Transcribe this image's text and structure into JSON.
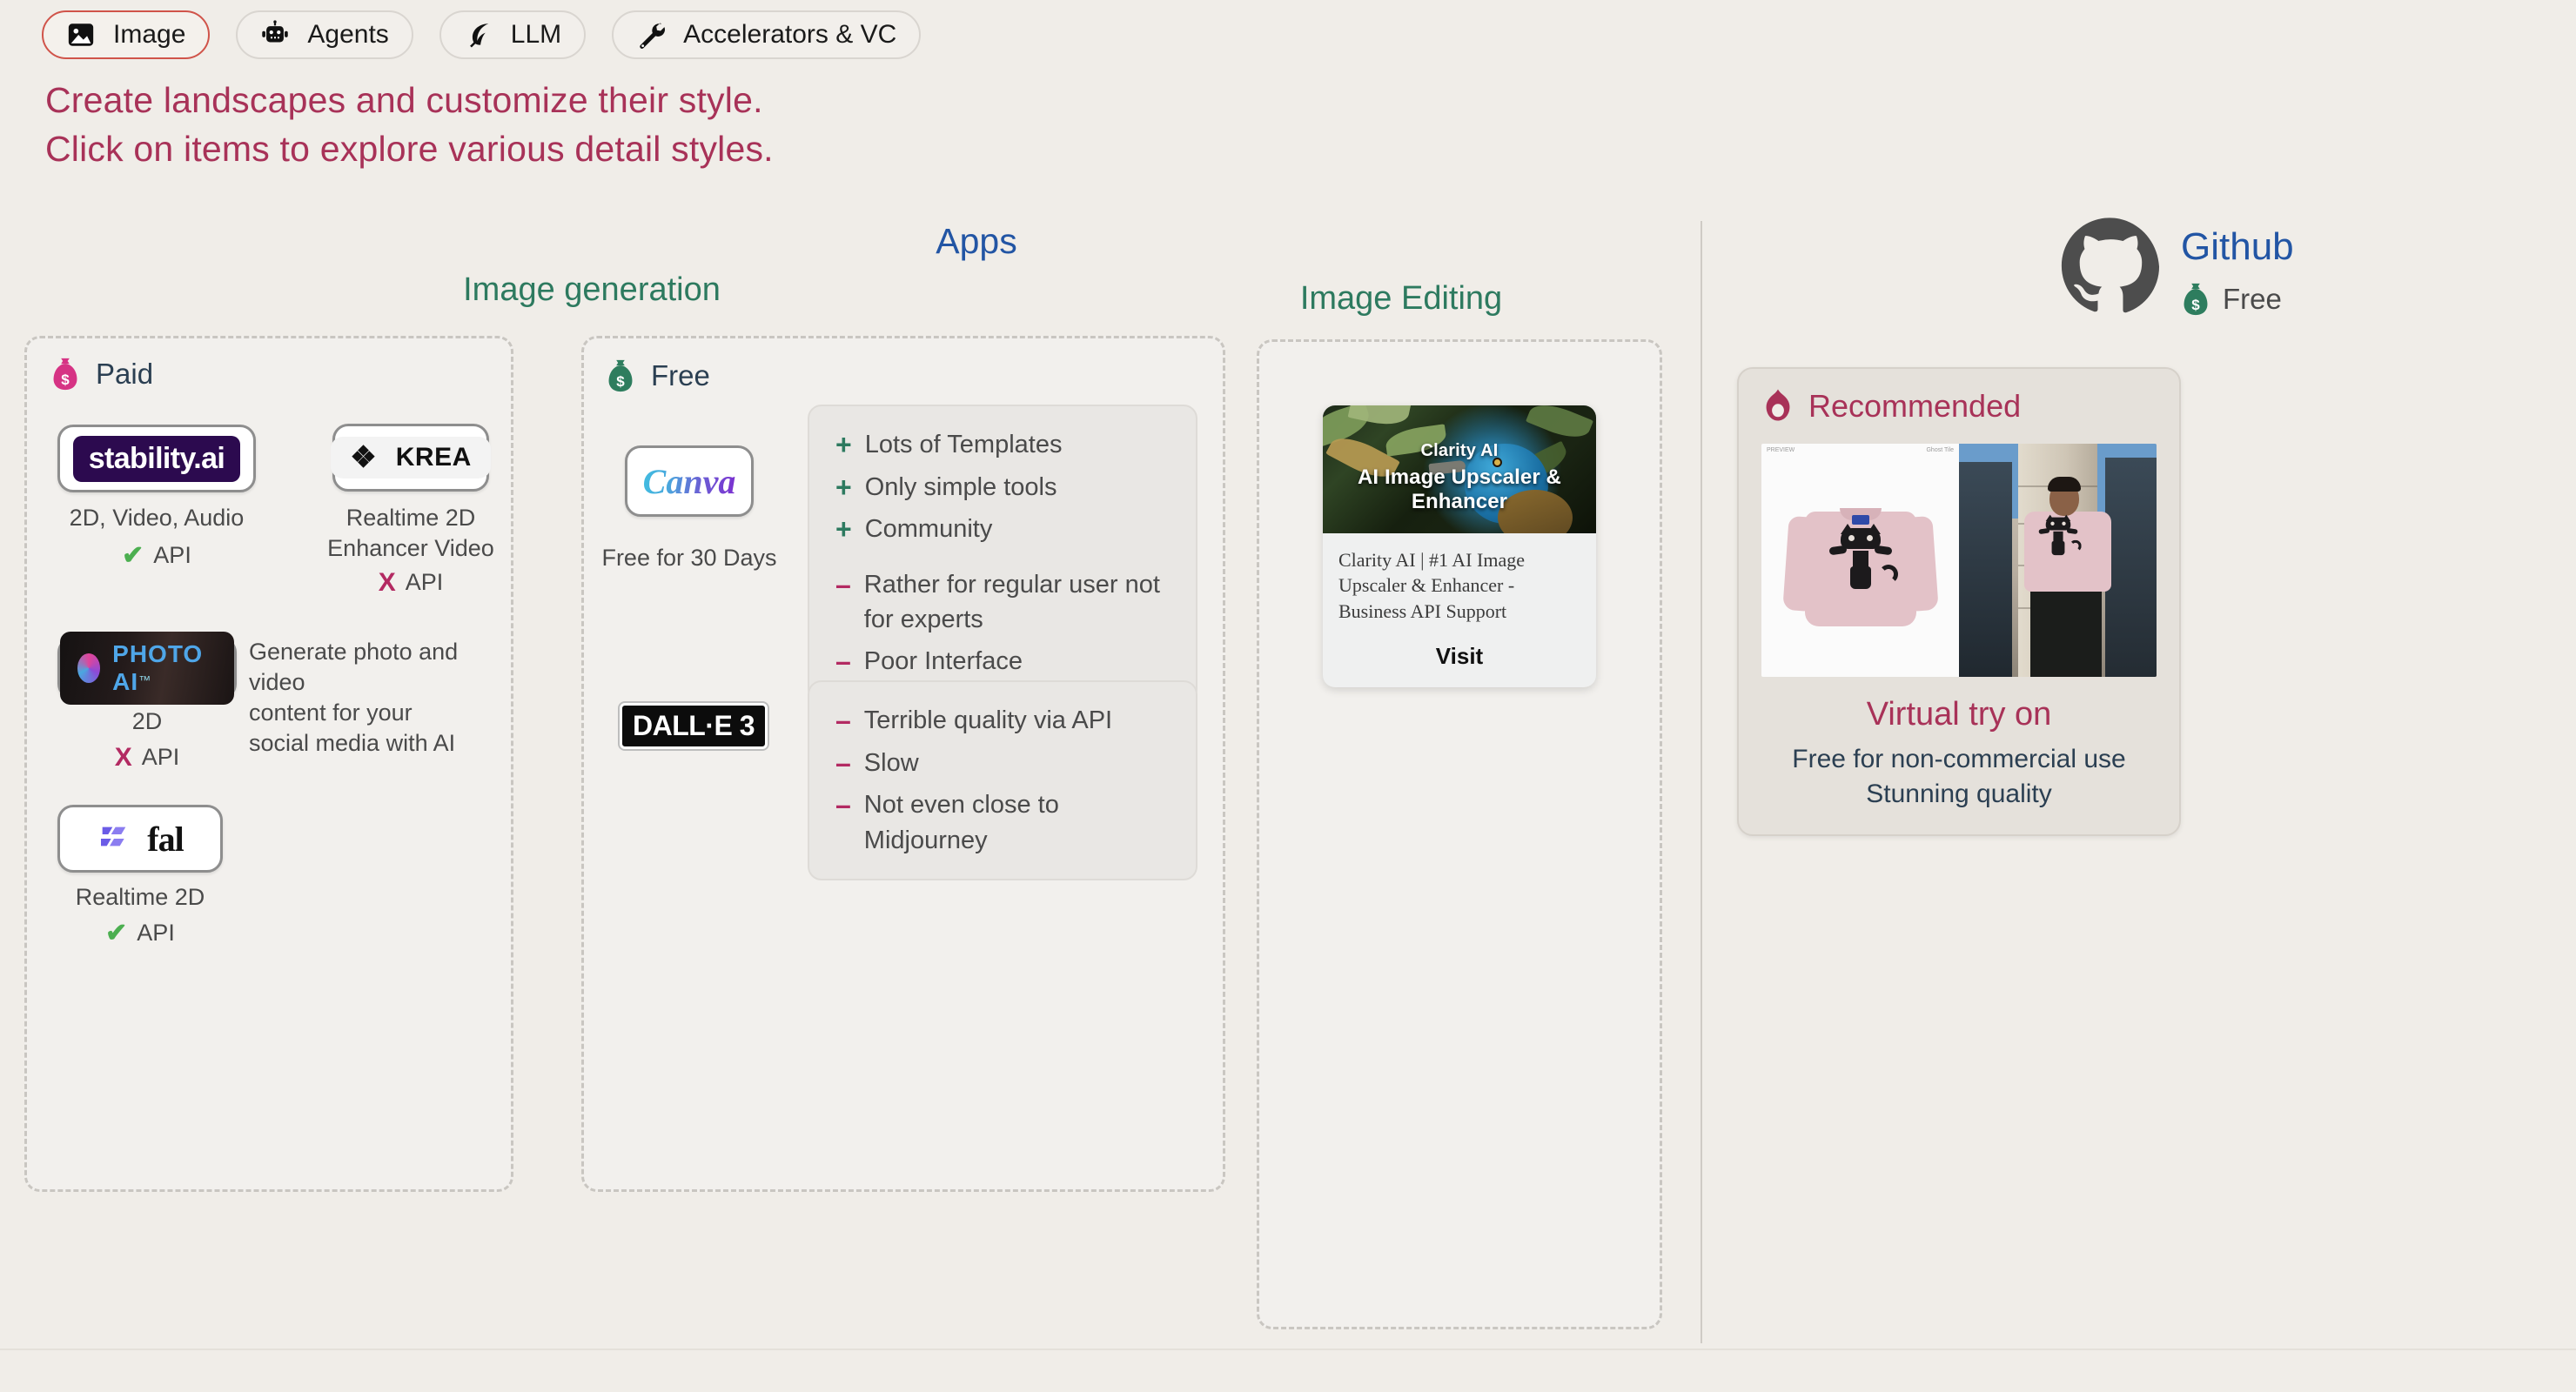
{
  "tabs": [
    {
      "label": "Image",
      "icon": "image-icon",
      "active": true
    },
    {
      "label": "Agents",
      "icon": "robot-icon",
      "active": false
    },
    {
      "label": "LLM",
      "icon": "feather-icon",
      "active": false
    },
    {
      "label": "Accelerators & VC",
      "icon": "wrench-icon",
      "active": false
    }
  ],
  "headline": {
    "line1": "Create landscapes and customize their style.",
    "line2": "Click on items to explore various detail styles."
  },
  "sections": {
    "apps_title": "Apps",
    "image_generation_title": "Image generation",
    "image_editing_title": "Image Editing"
  },
  "paid_column": {
    "tag": "Paid",
    "tag_icon": "money-bag-icon",
    "items": [
      {
        "logo": "stability.ai",
        "logo_dot": ".",
        "caption": "2D, Video, Audio",
        "api_mark": "✔",
        "api_label": "API"
      },
      {
        "logo": "KREA",
        "caption_line1": "Realtime 2D",
        "caption_line2": "Enhancer Video",
        "api_mark": "X",
        "api_label": "API"
      },
      {
        "logo": "PHOTO AI",
        "logo_tm": "™",
        "caption": "2D",
        "api_mark": "X",
        "api_label": "API",
        "description_line1": "Generate photo and video",
        "description_line2": "content for your",
        "description_line3": "social media with AI"
      },
      {
        "logo": "fal",
        "caption": "Realtime 2D",
        "api_mark": "✔",
        "api_label": "API"
      }
    ]
  },
  "free_column": {
    "tag": "Free",
    "tag_icon": "money-bag-icon",
    "items": [
      {
        "logo": "Canva",
        "caption": "Free for 30 Days",
        "pros": [
          "Lots of Templates",
          "Only simple tools",
          "Community"
        ],
        "cons": [
          "Rather for regular user not for experts",
          "Poor Interface"
        ]
      },
      {
        "logo": "DALL·E 3",
        "pros": [],
        "cons": [
          "Terrible quality via API",
          "Slow",
          "Not even close to Midjourney"
        ]
      }
    ],
    "plus_symbol": "+",
    "minus_symbol": "–"
  },
  "image_editing_column": {
    "card": {
      "overlay_title": "Clarity AI",
      "overlay_subtitle": "AI Image Upscaler & Enhancer",
      "description": "Clarity AI | #1 AI Image Upscaler & Enhancer - Business API Support",
      "visit_label": "Visit"
    }
  },
  "github": {
    "title": "Github",
    "logo_icon": "github-icon",
    "price_icon": "money-bag-icon",
    "price_label": "Free"
  },
  "recommended": {
    "badge_icon": "flame-icon",
    "badge_label": "Recommended",
    "preview_label": "PREVIEW",
    "preview_label_right": "Ghost Tile",
    "title": "Virtual try on",
    "sub_line1": "Free for non-commercial use",
    "sub_line2": "Stunning quality"
  },
  "colors": {
    "background": "#f0ede8",
    "accent_pink": "#a83258",
    "accent_blue": "#2255a4",
    "accent_green": "#2d7a5f",
    "tab_active_border": "#d0544a",
    "check_green": "#4caf50",
    "cross_pink": "#b32a62"
  }
}
